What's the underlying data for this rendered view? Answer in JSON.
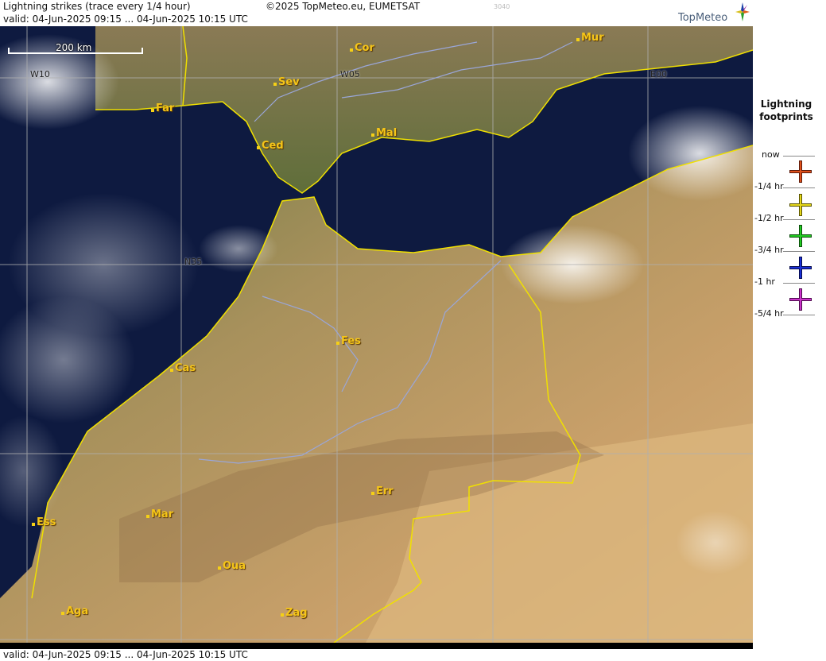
{
  "header": {
    "title": "Lightning strikes (trace every 1/4 hour)",
    "credit": "©2025 TopMeteo.eu, EUMETSAT",
    "code": "3040",
    "valid": "valid:  04-Jun-2025 09:15 ... 04-Jun-2025 10:15 UTC"
  },
  "brand": {
    "name": "TopMeteo",
    "icon": "compass-star-icon"
  },
  "scale": {
    "label": "200 km"
  },
  "grid_labels": {
    "w10": "W10",
    "w05": "W05",
    "e00": "E00",
    "n35": "N35"
  },
  "cities": [
    {
      "key": "cor",
      "name": "Cor"
    },
    {
      "key": "mur",
      "name": "Mur"
    },
    {
      "key": "sev",
      "name": "Sev"
    },
    {
      "key": "far",
      "name": "Far"
    },
    {
      "key": "ced",
      "name": "Ced"
    },
    {
      "key": "mal",
      "name": "Mal"
    },
    {
      "key": "fes",
      "name": "Fes"
    },
    {
      "key": "cas",
      "name": "Cas"
    },
    {
      "key": "err",
      "name": "Err"
    },
    {
      "key": "mar",
      "name": "Mar"
    },
    {
      "key": "ess",
      "name": "Ess"
    },
    {
      "key": "oua",
      "name": "Oua"
    },
    {
      "key": "aga",
      "name": "Aga"
    },
    {
      "key": "zag",
      "name": "Zag"
    }
  ],
  "legend": {
    "title_line1": "Lightning",
    "title_line2": "footprints",
    "items": [
      {
        "label": "now",
        "color": "#e0501a"
      },
      {
        "label": "-1/4 hr",
        "color": "#e6d81a"
      },
      {
        "label": "-1/2 hr",
        "color": "#22cc22"
      },
      {
        "label": "-3/4 hr",
        "color": "#1a2fd6"
      },
      {
        "label": "-1 hr",
        "color": "#cc33cc"
      },
      {
        "label": "-5/4 hr",
        "color": ""
      }
    ]
  },
  "footer": {
    "valid": "valid:  04-Jun-2025 09:15 ... 04-Jun-2025 10:15 UTC"
  },
  "colors": {
    "sea": "#0e1a40",
    "land": "#c9a06a",
    "border": "#f0e000",
    "river": "#9aa6d8",
    "grid": "#b0b0b0"
  }
}
